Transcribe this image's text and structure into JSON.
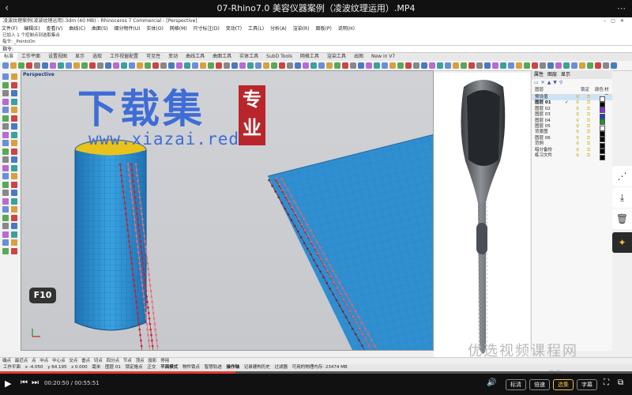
{
  "video": {
    "title": "07-Rhino7.0 美容仪器案例（凌波纹理运用）.MP4",
    "time_current": "00:20:50",
    "time_total": "00:55:51",
    "progress_fraction": 0.373,
    "btn_quality": "标清",
    "btn_speed": "倍速",
    "btn_select": "选集",
    "btn_subtitle": "字幕"
  },
  "app": {
    "window_title": "凌波纹理案例(凌波纹理运用).3dm (40 MB) - Rhinoceros 7 Commercial - [Perspective]",
    "menus": [
      "文件(F)",
      "编辑(E)",
      "查看(V)",
      "曲线(C)",
      "曲面(S)",
      "细分物件(U)",
      "实体(O)",
      "网格(M)",
      "尺寸标注(D)",
      "变动(T)",
      "工具(L)",
      "分析(A)",
      "渲染(R)",
      "面板(P)",
      "说明(H)"
    ],
    "cmd_history_1": "已加入 1 个控制点到选取集合",
    "cmd_history_2": "指令: _PointsOn",
    "cmd_prompt": "指令:",
    "tabs": [
      "标准",
      "工作平面",
      "设置视图",
      "显示",
      "选取",
      "工作视窗配置",
      "可见性",
      "变动",
      "曲线工具",
      "曲面工具",
      "实体工具",
      "SubD Tools",
      "网格工具",
      "渲染工具",
      "出图",
      "New in V7"
    ],
    "viewport_label": "Perspective",
    "f10_badge": "F10"
  },
  "layers": {
    "tabs": [
      "属性",
      "图层",
      "显示"
    ],
    "header": {
      "name": "图层",
      "lock": "锁定",
      "color": "颜色",
      "material": "材质"
    },
    "rows": [
      {
        "name": "预设值",
        "current": false,
        "color": "#ffffff",
        "selected": true
      },
      {
        "name": "图层 01",
        "current": true,
        "color": "#000000",
        "selected": false
      },
      {
        "name": "图层 02",
        "current": false,
        "color": "#8a2be2",
        "selected": false
      },
      {
        "name": "图层 03",
        "current": false,
        "color": "#1a3fc4",
        "selected": false
      },
      {
        "name": "图层 04",
        "current": false,
        "color": "#1d9a2c",
        "selected": false
      },
      {
        "name": "图层 05",
        "current": false,
        "color": "#ffffff",
        "selected": false
      },
      {
        "name": "背景图",
        "current": false,
        "color": "#000000",
        "selected": false
      },
      {
        "name": "图层 06",
        "current": false,
        "color": "#000000",
        "selected": false
      },
      {
        "name": "范例",
        "current": false,
        "color": "#000000",
        "selected": false
      },
      {
        "name": "暗分备份",
        "current": false,
        "color": "#000000",
        "selected": false
      },
      {
        "name": "练习文件",
        "current": false,
        "color": "#000000",
        "selected": false
      }
    ]
  },
  "status": {
    "snaps": [
      "端点",
      "最近点",
      "点",
      "中点",
      "中心点",
      "交点",
      "垂点",
      "切点",
      "四分点",
      "节点",
      "顶点",
      "投影",
      "停用"
    ],
    "workplane": "工作平面",
    "x": "x -4.050",
    "y": "y 64.195",
    "z": "z 0.000",
    "units": "毫米",
    "layer": "图层 01",
    "modes": [
      "锁定格点",
      "正交",
      "平面模式",
      "物件锁点",
      "智慧轨迹",
      "操作轴",
      "记录建构历史",
      "过滤器"
    ],
    "memory": "可用的物理内存: 23474 MB"
  },
  "watermarks": {
    "main": "下载集",
    "seal": "专业",
    "url": "www.xiazai.red",
    "brand": "优选视频课程网",
    "brand_url": "www.youxuan68.com"
  },
  "colors": {
    "surface_blue": "#2f8fd0",
    "mesh_line": "#1d5f98",
    "inner_yellow": "#e9c21c",
    "pattern_red": "#c4212f",
    "accent_red": "#e53935"
  }
}
